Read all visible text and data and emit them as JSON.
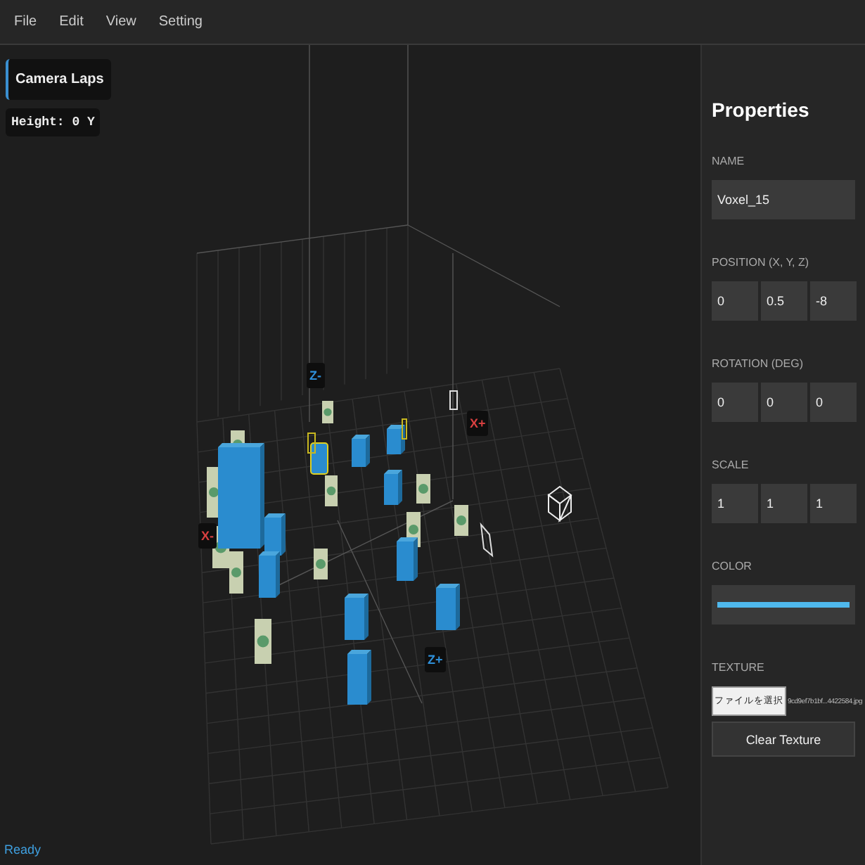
{
  "menu": [
    "File",
    "Edit",
    "View",
    "Setting"
  ],
  "viewport": {
    "overlays": [
      {
        "label": "Camera Laps",
        "kind": "button"
      },
      {
        "label": "Height: 0 Y",
        "kind": "readout"
      }
    ],
    "axis_labels": [
      {
        "label": "Z-",
        "color": "#2f8fd8"
      },
      {
        "label": "X+",
        "color": "#d84040"
      },
      {
        "label": "X-",
        "color": "#d84040"
      },
      {
        "label": "Z+",
        "color": "#2f8fd8"
      }
    ],
    "status": "Ready"
  },
  "properties": {
    "title": "Properties",
    "name": {
      "label": "NAME",
      "value": "Voxel_15"
    },
    "vectors": [
      {
        "label": "POSITION (X, Y, Z)",
        "values": [
          "0",
          "0.5",
          "-8"
        ]
      },
      {
        "label": "ROTATION (DEG)",
        "values": [
          "0",
          "0",
          "0"
        ]
      },
      {
        "label": "SCALE",
        "values": [
          "1",
          "1",
          "1"
        ]
      }
    ],
    "color": {
      "label": "COLOR",
      "color": "#4fb8ec"
    },
    "texture": {
      "label": "TEXTURE",
      "choose_button": "ファイルを選択",
      "file_name": "9cd9ef7b1bf...4422584.jpg",
      "clear_button": "Clear Texture"
    }
  }
}
